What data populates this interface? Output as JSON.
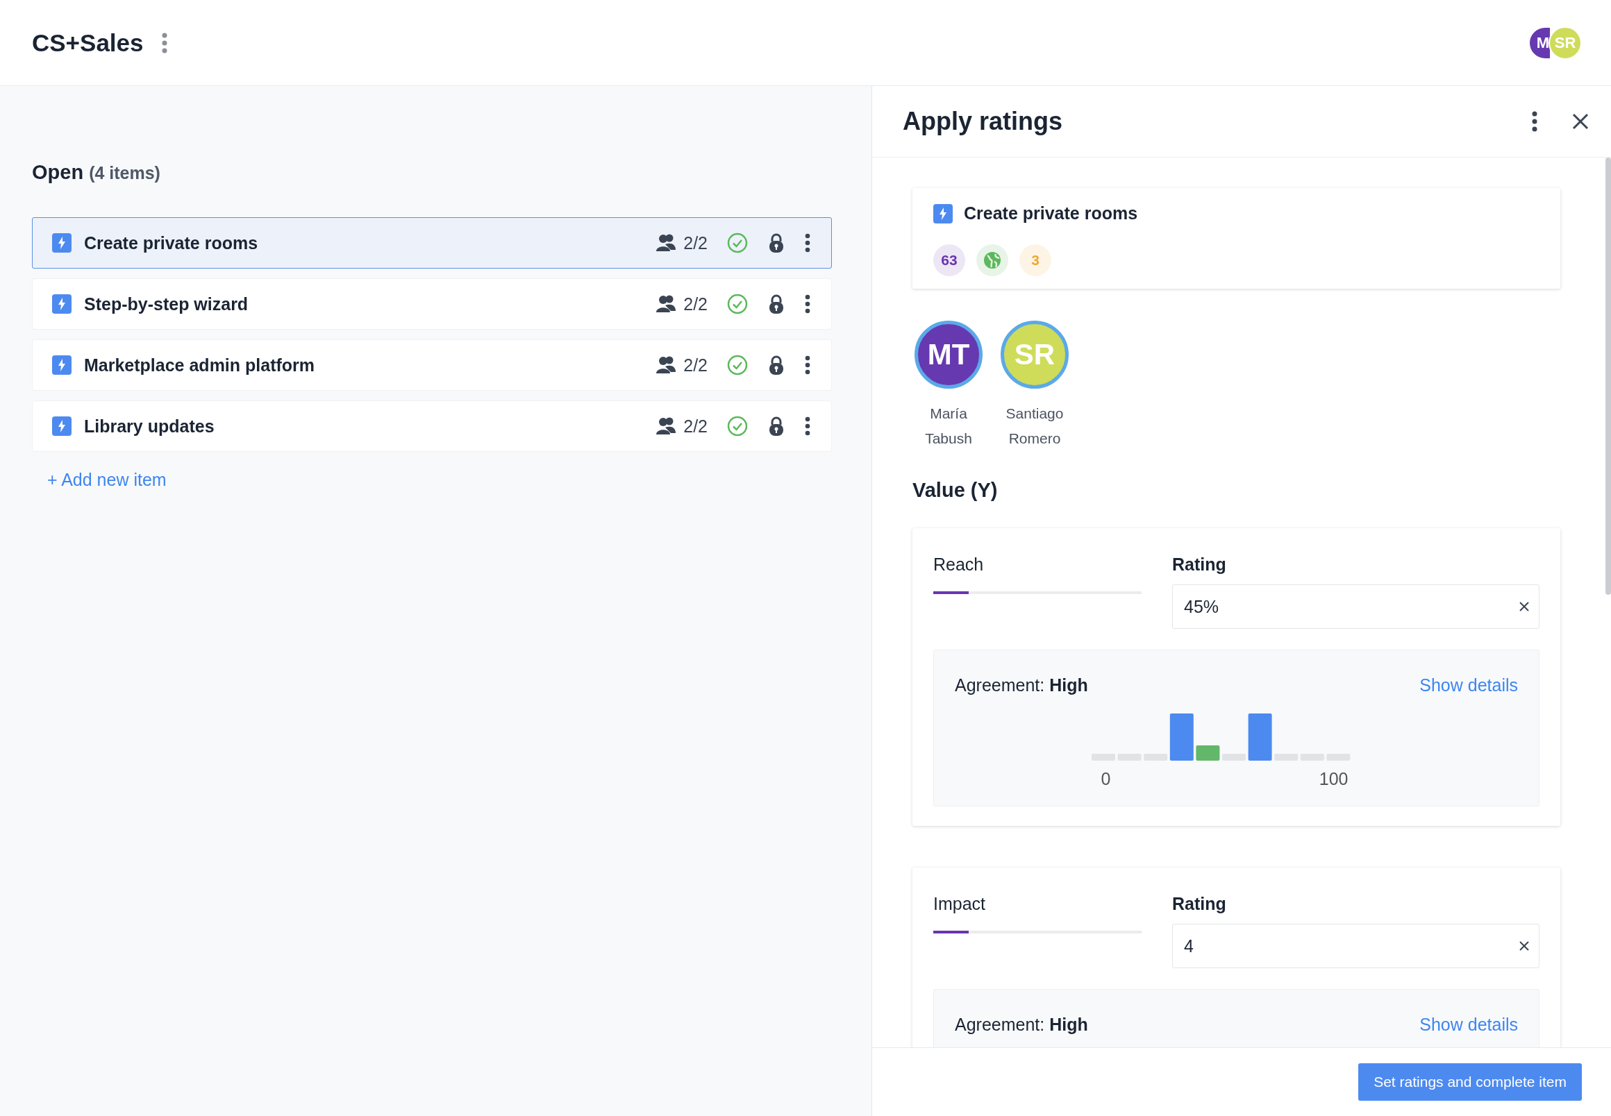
{
  "header": {
    "title": "CS+Sales",
    "avatars": [
      {
        "initials": "M",
        "color": "#6639b0"
      },
      {
        "initials": "SR",
        "color": "#cfdc5a"
      }
    ]
  },
  "list": {
    "title": "Open",
    "count": "(4 items)",
    "add_link": "+ Add new item",
    "items": [
      {
        "title": "Create private rooms",
        "raters": "2/2",
        "selected": true
      },
      {
        "title": "Step-by-step wizard",
        "raters": "2/2",
        "selected": false
      },
      {
        "title": "Marketplace admin platform",
        "raters": "2/2",
        "selected": false
      },
      {
        "title": "Library updates",
        "raters": "2/2",
        "selected": false
      }
    ]
  },
  "panel": {
    "title": "Apply ratings",
    "item": {
      "title": "Create private rooms",
      "badges": [
        {
          "kind": "number",
          "text": "63",
          "color": "#6a35b0"
        },
        {
          "kind": "globe",
          "color": "#5cb85c"
        },
        {
          "kind": "number",
          "text": "3",
          "color": "#f0a830"
        }
      ]
    },
    "raters": [
      {
        "initials": "MT",
        "name": "María Tabush",
        "color": "#6639b0"
      },
      {
        "initials": "SR",
        "name": "Santiago Romero",
        "color": "#cfdc5a"
      }
    ],
    "section": "Value (Y)",
    "factors": [
      {
        "name": "Reach",
        "level": 0.17,
        "rating_label": "Rating",
        "value": "45%",
        "agreement_label": "Agreement:",
        "agreement": "High",
        "details": "Show details",
        "axis_min": "0",
        "axis_max": "100"
      },
      {
        "name": "Impact",
        "level": 0.17,
        "rating_label": "Rating",
        "value": "4",
        "agreement_label": "Agreement:",
        "agreement": "High",
        "details": "Show details"
      }
    ],
    "button": "Set ratings and complete item"
  }
}
